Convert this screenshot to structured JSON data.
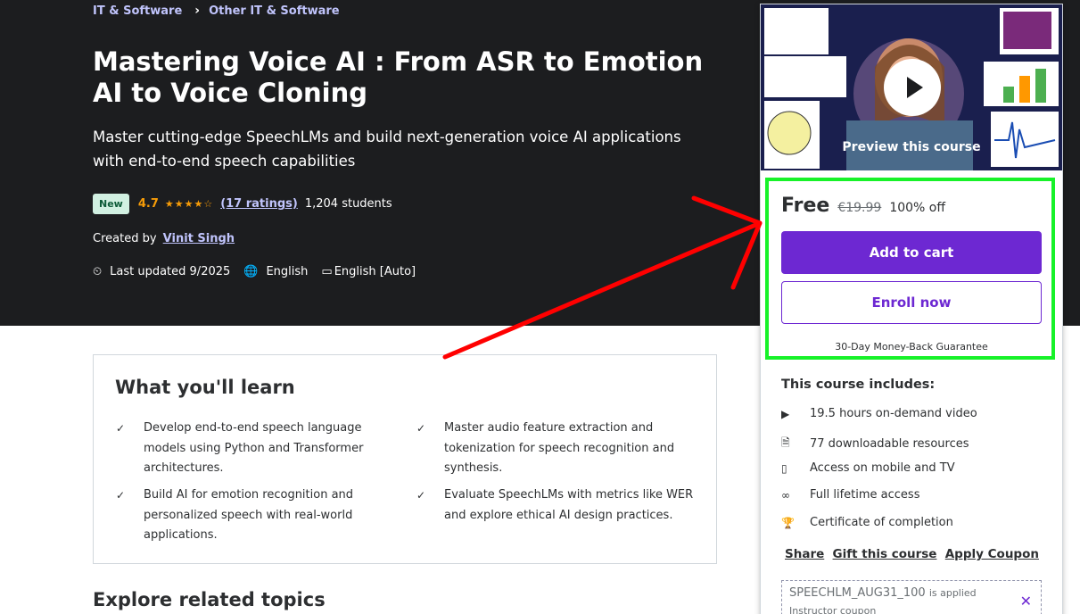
{
  "breadcrumb": {
    "items": [
      "IT & Software",
      "Other IT & Software"
    ],
    "separator": "›"
  },
  "course": {
    "title": "Mastering Voice AI : From ASR to Emotion AI to Voice Cloning",
    "subtitle": "Master cutting-edge SpeechLMs and build next-generation voice AI applications with end-to-end speech capabilities",
    "badge": "New",
    "rating": "4.7",
    "stars": "★★★★☆",
    "ratings_link": "(17 ratings)",
    "students": "1,204 students",
    "created_by_label": "Created by",
    "author": "Vinit Singh",
    "last_updated": "Last updated 9/2025",
    "language": "English",
    "captions": "English [Auto]"
  },
  "learn": {
    "title": "What you'll learn",
    "items": [
      "Develop end-to-end speech language models using Python and Transformer architectures.",
      "Master audio feature extraction and tokenization for speech recognition and synthesis.",
      "Build AI for emotion recognition and personalized speech with real-world applications.",
      "Evaluate SpeechLMs with metrics like WER and explore ethical AI design practices."
    ]
  },
  "explore_title": "Explore related topics",
  "sidebar": {
    "preview_label": "Preview this course",
    "price": "Free",
    "original_price": "€19.99",
    "discount": "100% off",
    "add_to_cart": "Add to cart",
    "enroll_now": "Enroll now",
    "guarantee": "30-Day Money-Back Guarantee",
    "includes_title": "This course includes:",
    "includes": [
      {
        "icon": "video-icon",
        "text": "19.5 hours on-demand video"
      },
      {
        "icon": "file-download-icon",
        "text": "77 downloadable resources"
      },
      {
        "icon": "mobile-icon",
        "text": "Access on mobile and TV"
      },
      {
        "icon": "infinity-icon",
        "text": "Full lifetime access"
      },
      {
        "icon": "trophy-icon",
        "text": "Certificate of completion"
      }
    ],
    "share": "Share",
    "gift": "Gift this course",
    "apply_coupon": "Apply Coupon",
    "coupon_code": "SPEECHLM_AUG31_100",
    "coupon_applied": "is applied",
    "coupon_type": "Instructor coupon"
  },
  "colors": {
    "hero_bg": "#1c1d1f",
    "accent": "#6d28d2",
    "link": "#c0c4fc",
    "star": "#f69c08",
    "highlight_box": "#17f229",
    "annotation_arrow": "#ff0000"
  }
}
